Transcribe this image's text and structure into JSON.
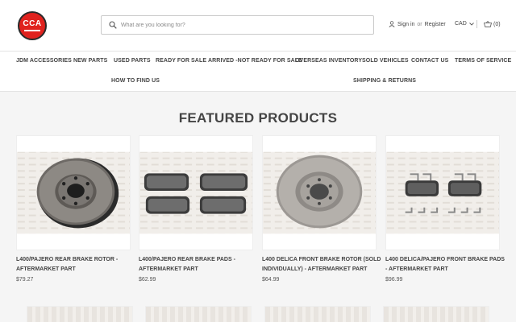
{
  "header": {
    "logo_text": "CCA",
    "search_placeholder": "What are you looking for?",
    "sign_in": "Sign in",
    "or": "or",
    "register": "Register",
    "currency": "CAD",
    "cart": "(0)"
  },
  "nav": [
    {
      "label": "JDM ACCESSORIES"
    },
    {
      "label": "NEW PARTS"
    },
    {
      "label": "USED PARTS"
    },
    {
      "label": "READY FOR SALE"
    },
    {
      "label": "ARRIVED -NOT READY FOR SALE"
    },
    {
      "label": "OVERSEAS INVENTORY"
    },
    {
      "label": "SOLD VEHICLES"
    },
    {
      "label": "CONTACT US"
    },
    {
      "label": "TERMS OF SERVICE"
    },
    {
      "label": "HOW TO FIND US"
    },
    {
      "label": "SHIPPING & RETURNS"
    }
  ],
  "featured_title": "FEATURED PRODUCTS",
  "products": [
    {
      "name": "L400/PAJERO REAR BRAKE ROTOR - AFTERMARKET PART",
      "price": "$79.27",
      "image": "brake-rotor-rear"
    },
    {
      "name": "L400/PAJERO REAR BRAKE PADS - AFTERMARKET PART",
      "price": "$62.99",
      "image": "brake-pads-rear"
    },
    {
      "name": "L400 DELICA FRONT BRAKE ROTOR (SOLD INDIVIDUALLY) - AFTERMARKET PART",
      "price": "$64.99",
      "image": "brake-rotor-front"
    },
    {
      "name": "L400 DELICA/PAJERO FRONT BRAKE PADS - AFTERMARKET PART",
      "price": "$96.99",
      "image": "brake-pads-front"
    }
  ],
  "colors": {
    "logo_red": "#e0221e",
    "text_dark": "#444444",
    "background": "#f5f5f5"
  }
}
